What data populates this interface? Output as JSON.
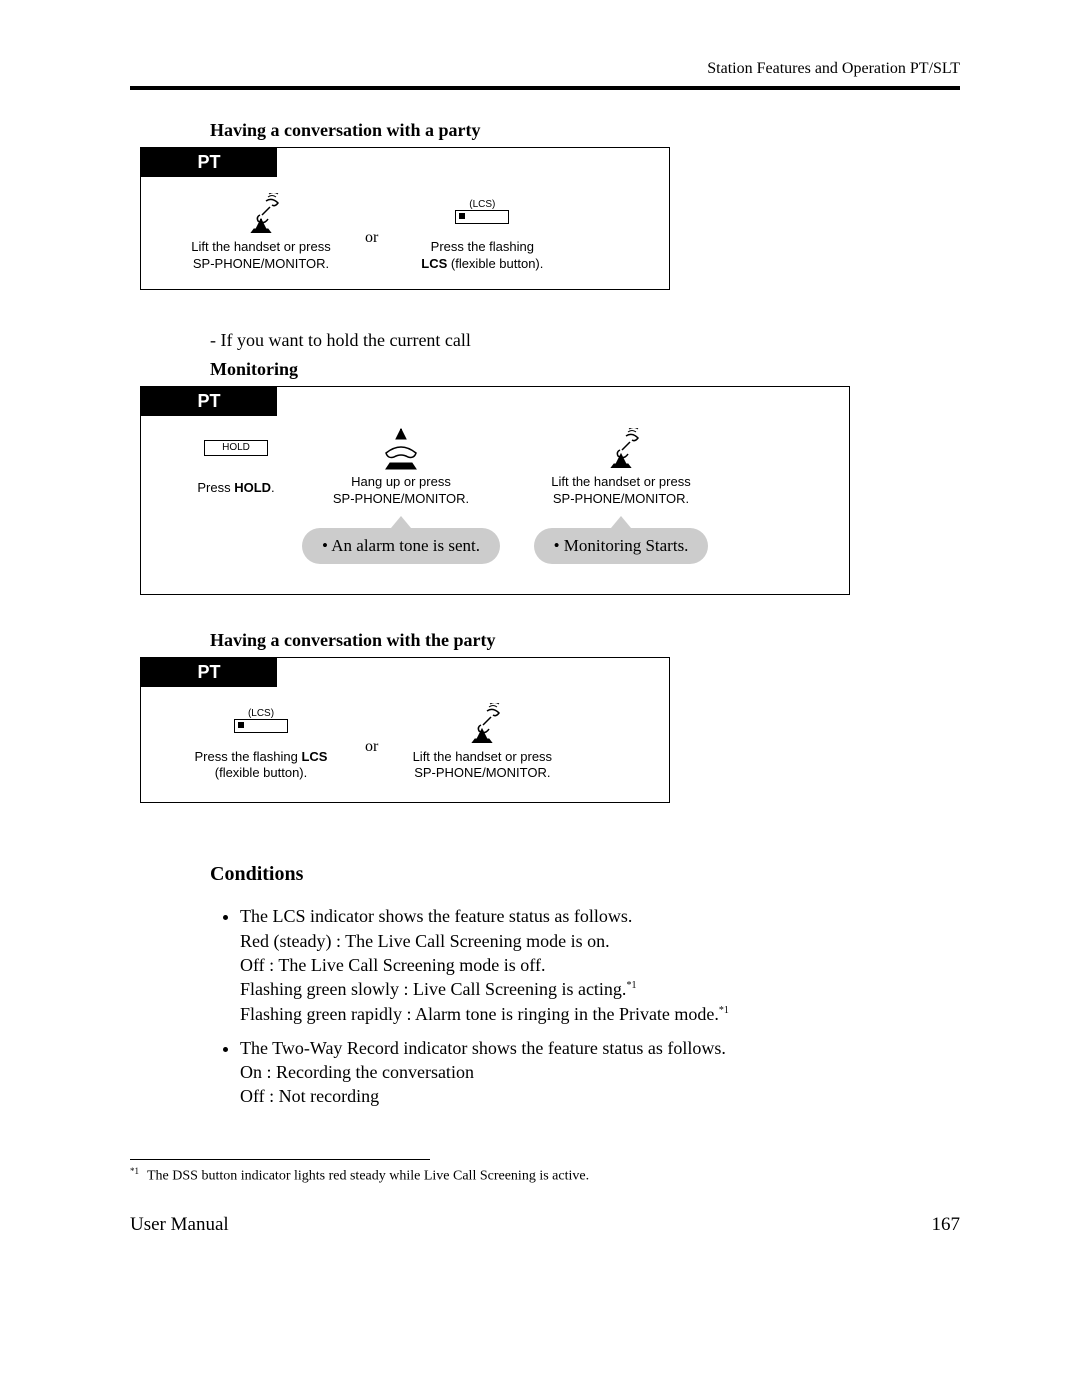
{
  "header": "Station Features and Operation PT/SLT",
  "pt_label": "PT",
  "section1": {
    "title": "Having a conversation with a party",
    "step1_caption_l1": "Lift the handset or press",
    "step1_caption_l2": "SP-PHONE/MONITOR.",
    "or": "or",
    "lcs_label": "(LCS)",
    "step2_caption_l1": "Press the flashing",
    "step2_bold": "LCS",
    "step2_caption_l2": " (flexible button)."
  },
  "holdnote": "- If you want to hold the current call",
  "section2": {
    "title": "Monitoring",
    "hold_label": "HOLD",
    "hold_caption_pre": "Press ",
    "hold_caption_bold": "HOLD",
    "hold_caption_post": ".",
    "hang_l1": "Hang up or press",
    "hang_l2": "SP-PHONE/MONITOR.",
    "lift_l1": "Lift the handset or press",
    "lift_l2": "SP-PHONE/MONITOR.",
    "bubble1": "•  An alarm tone is sent.",
    "bubble2": "•  Monitoring Starts."
  },
  "section3": {
    "title": "Having a conversation with the party",
    "lcs_label": "(LCS)",
    "step1_l1_pre": "Press the flashing ",
    "step1_l1_bold": "LCS",
    "step1_l2": "(flexible button).",
    "or": "or",
    "step2_l1": "Lift the handset or press",
    "step2_l2": "SP-PHONE/MONITOR."
  },
  "conditions": {
    "heading": "Conditions",
    "item1_l1": "The LCS indicator shows the feature status as follows.",
    "item1_l2": "Red (steady) : The Live Call Screening mode is on.",
    "item1_l3": "Off : The Live Call Screening mode is off.",
    "item1_l4": "Flashing green slowly : Live Call Screening is acting.",
    "item1_l5": "Flashing green rapidly : Alarm tone is ringing in the Private mode.",
    "item1_sup": "*1",
    "item2_l1": "The Two-Way Record indicator shows the feature status as follows.",
    "item2_l2": "On : Recording the conversation",
    "item2_l3": "Off : Not recording"
  },
  "footnote": {
    "marker": "*1",
    "text": "The DSS button indicator lights red steady while Live Call Screening is active."
  },
  "footer": {
    "left": "User Manual",
    "right": "167"
  }
}
